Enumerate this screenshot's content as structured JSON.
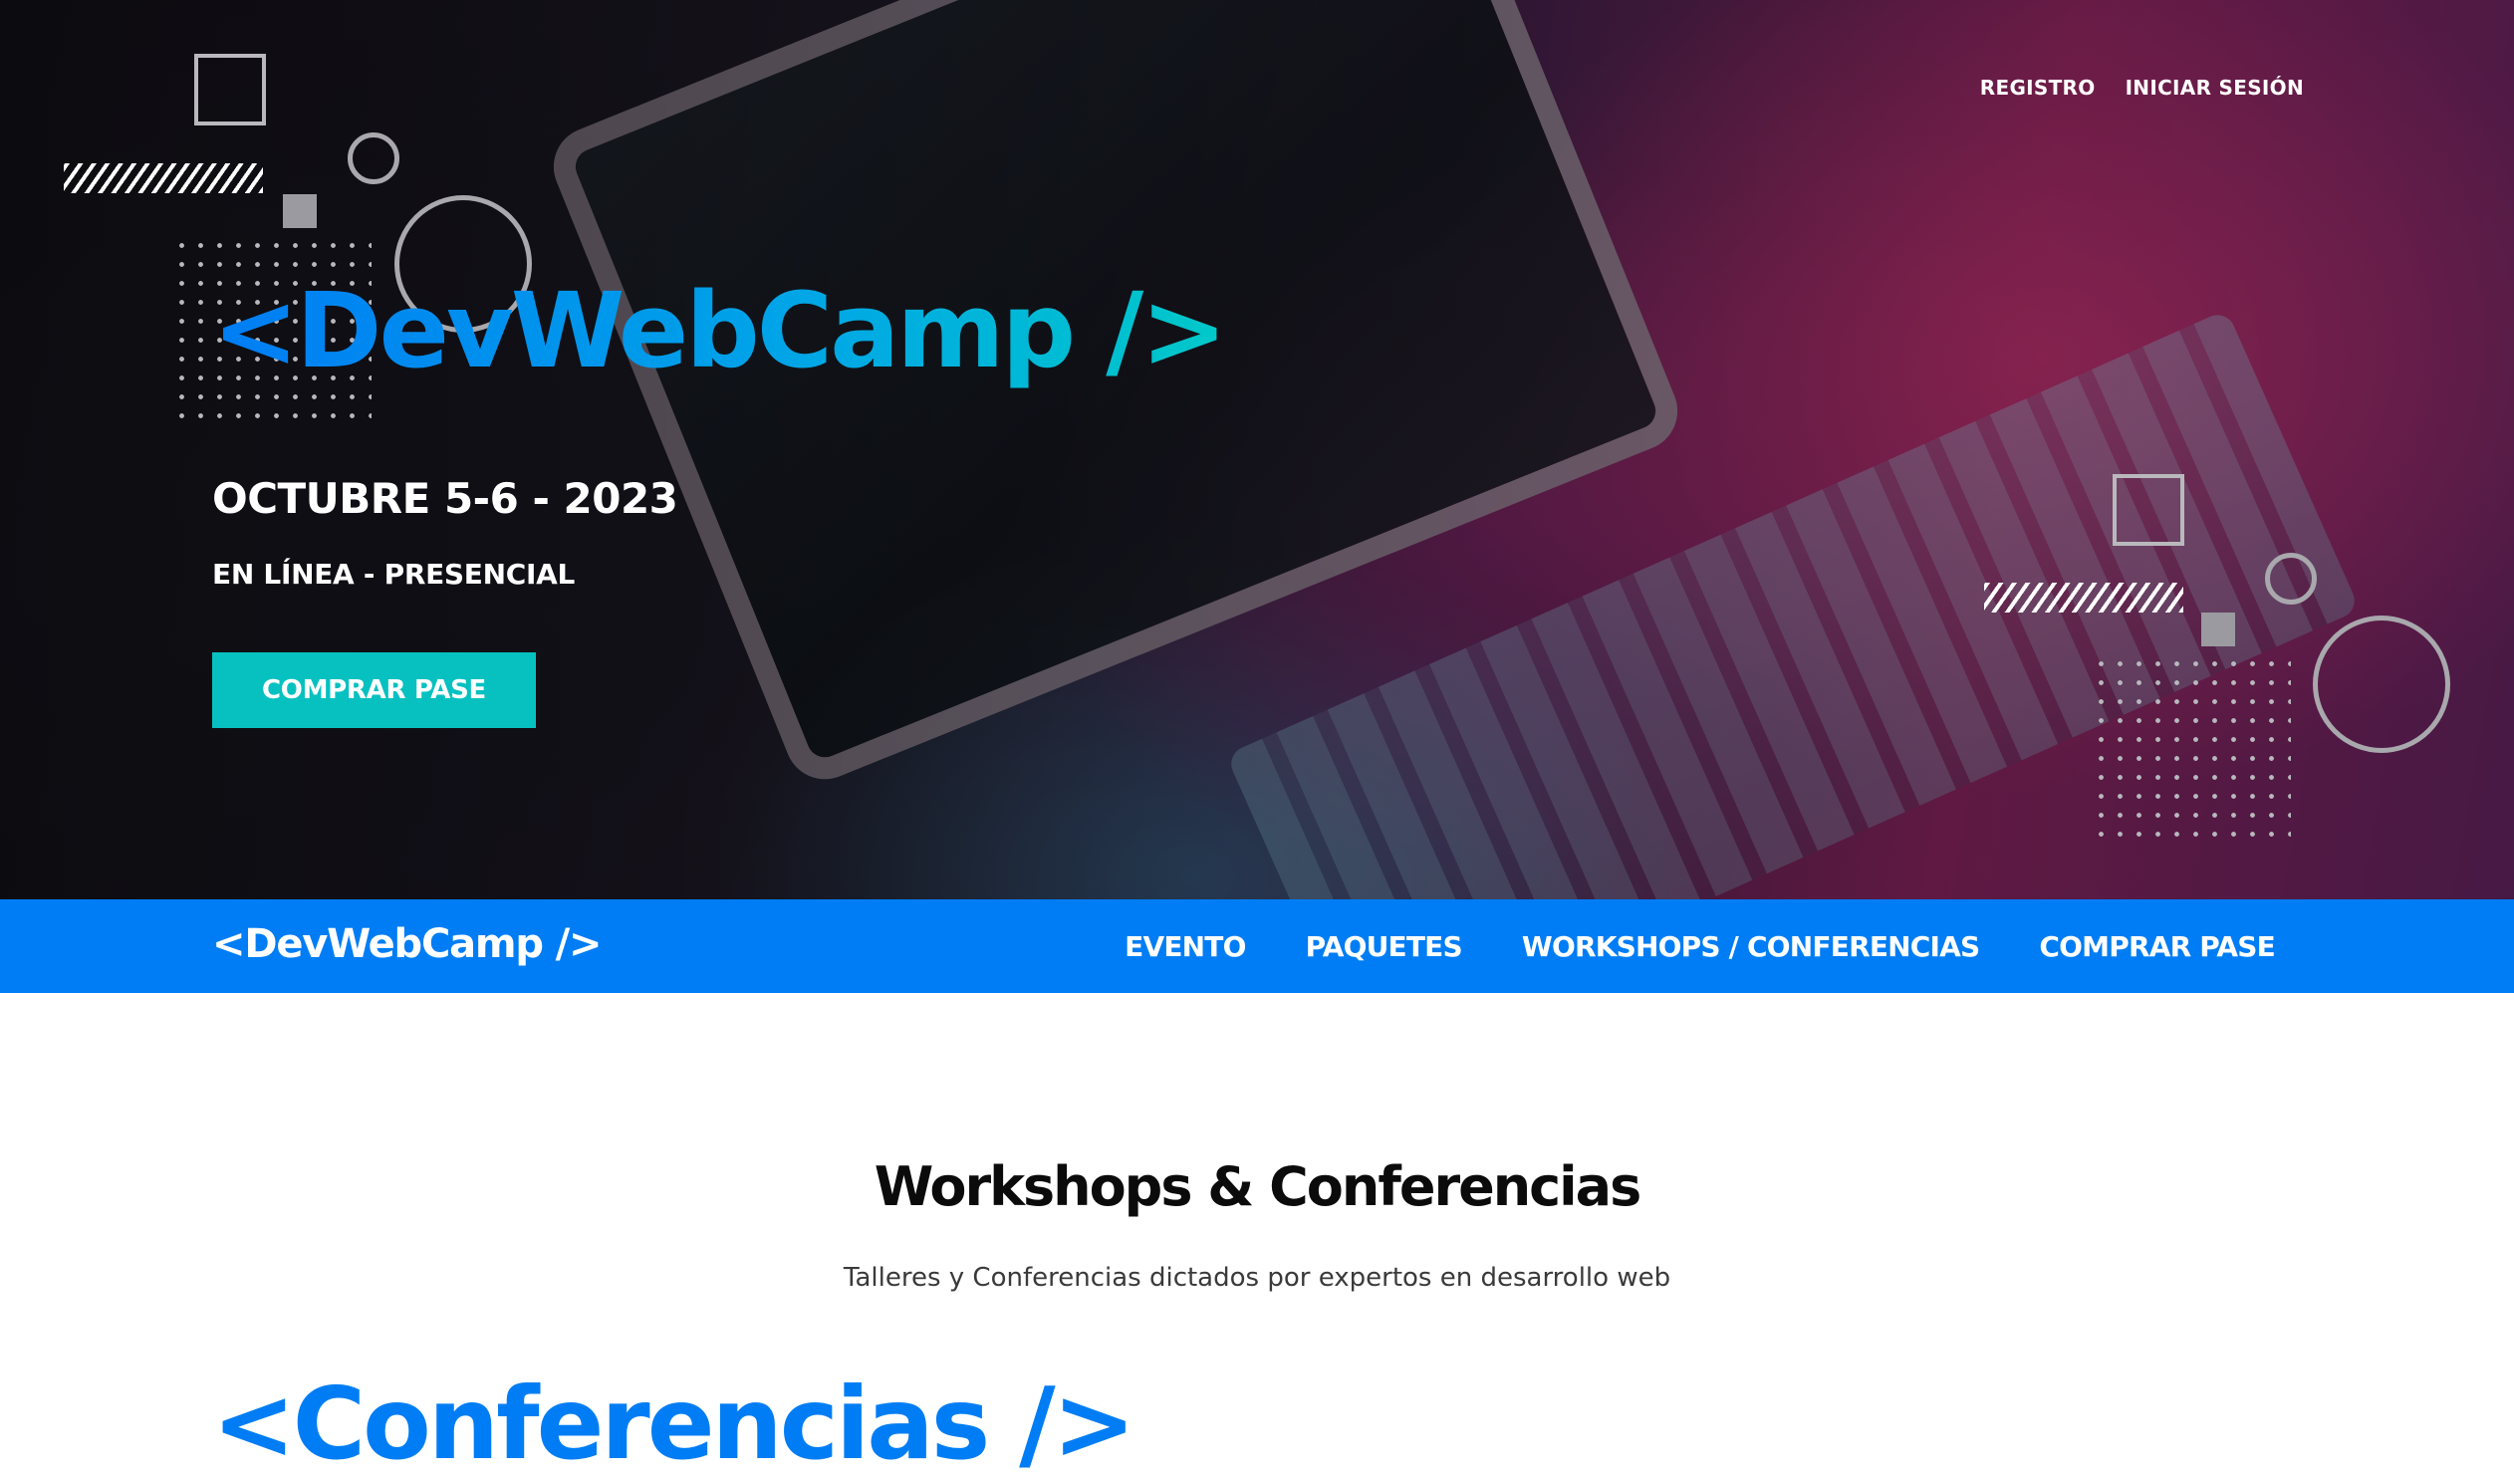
{
  "header": {
    "auth_links": {
      "register": "REGISTRO",
      "login": "INICIAR SESIÓN"
    },
    "logo": "<DevWebCamp />",
    "date": "OCTUBRE 5-6 - 2023",
    "modality": "EN LÍNEA - PRESENCIAL",
    "cta": "COMPRAR PASE"
  },
  "navbar": {
    "logo": "<DevWebCamp />",
    "links": [
      "EVENTO",
      "PAQUETES",
      "WORKSHOPS / CONFERENCIAS",
      "COMPRAR PASE"
    ]
  },
  "main": {
    "title": "Workshops & Conferencias",
    "subtitle": "Talleres y Conferencias dictados por expertos en desarrollo web",
    "next_heading": "<Conferencias />"
  },
  "colors": {
    "brand_blue": "#007df4",
    "accent_teal": "#07c1c1",
    "white": "#ffffff",
    "text_dark": "#0b0b0b"
  }
}
